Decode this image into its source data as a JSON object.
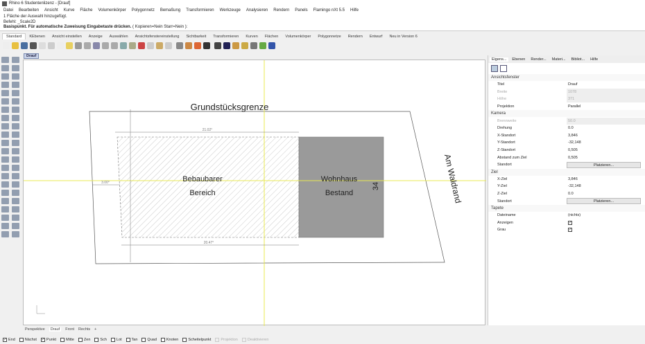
{
  "window": {
    "title": "Rhino 6 Studentenlizenz - [Drauf]"
  },
  "menu": [
    "Datei",
    "Bearbeiten",
    "Ansicht",
    "Kurve",
    "Fläche",
    "Volumenkörper",
    "Polygonnetz",
    "Bemaßung",
    "Transformieren",
    "Werkzeuge",
    "Analysieren",
    "Rendern",
    "Panels",
    "Flamingo nXt 5.5",
    "Hilfe"
  ],
  "command": {
    "history": [
      "1 Fläche der Auswahl hinzugefügt.",
      "Befehl: _Scale2D"
    ],
    "prompt": "Basispunkt. Für automatische Zuweisung Eingabetaste drücken.",
    "options": "( Kopieren=Nein  Starr=Nein ):"
  },
  "toolbar_tabs": [
    "Standard",
    "KEbenen",
    "Ansicht einstellen",
    "Anzeige",
    "Auswählen",
    "Ansichtsfenstereinstellung",
    "Sichtbarkeit",
    "Transformieren",
    "Kurven",
    "Flächen",
    "Volumenkörper",
    "Polygonnetze",
    "Rendern",
    "Entwurf",
    "Neu in Version 6"
  ],
  "viewport": {
    "name": "Drauf",
    "labels": {
      "plot": "Grundstücksgrenze",
      "area1": "Bebaubarer",
      "area2": "Bereich",
      "house1": "Wohnhaus",
      "house2": "Bestand",
      "number": "34",
      "street": "Am Waldrand",
      "dim_top": "21.02°",
      "dim_bottom": "20.47°",
      "dim_left": "3.00°"
    }
  },
  "view_tabs": [
    "Perspektive",
    "Drauf",
    "Front",
    "Rechts"
  ],
  "osnaps": [
    {
      "label": "End",
      "checked": true
    },
    {
      "label": "Nächst",
      "checked": false
    },
    {
      "label": "Punkt",
      "checked": true
    },
    {
      "label": "Mitte",
      "checked": false
    },
    {
      "label": "Zen",
      "checked": false
    },
    {
      "label": "Sch",
      "checked": false
    },
    {
      "label": "Lot",
      "checked": false
    },
    {
      "label": "Tan",
      "checked": false
    },
    {
      "label": "Quad",
      "checked": false
    },
    {
      "label": "Knoten",
      "checked": false
    },
    {
      "label": "Scheitelpunkt",
      "checked": false
    },
    {
      "label": "Projektion",
      "checked": false,
      "disabled": true
    },
    {
      "label": "Deaktivieren",
      "checked": false,
      "disabled": true
    }
  ],
  "panel": {
    "tabs": [
      "Eigens...",
      "Ebenen",
      "Render...",
      "Materi...",
      "Bibliot...",
      "Hilfe"
    ],
    "sections": [
      {
        "title": "Ansichtsfenster",
        "rows": [
          {
            "k": "Titel",
            "v": "Drauf"
          },
          {
            "k": "Breite",
            "v": "1078",
            "gray": true
          },
          {
            "k": "Höhe",
            "v": "371",
            "gray": true
          },
          {
            "k": "Projektion",
            "v": "Parallel"
          }
        ]
      },
      {
        "title": "Kamera",
        "rows": [
          {
            "k": "Brennweite",
            "v": "50.0",
            "gray": true
          },
          {
            "k": "Drehung",
            "v": "0.0"
          },
          {
            "k": "X-Standort",
            "v": "3,846"
          },
          {
            "k": "Y-Standort",
            "v": "-32,148"
          },
          {
            "k": "Z-Standort",
            "v": "0,505"
          },
          {
            "k": "Abstand zum Ziel",
            "v": "0,505"
          },
          {
            "k": "Standort",
            "btn": "Platzieren..."
          }
        ]
      },
      {
        "title": "Ziel",
        "rows": [
          {
            "k": "X-Ziel",
            "v": "3,846"
          },
          {
            "k": "Y-Ziel",
            "v": "-32,148"
          },
          {
            "k": "Z-Ziel",
            "v": "0.0"
          },
          {
            "k": "Standort",
            "btn": "Platzieren..."
          }
        ]
      },
      {
        "title": "Tapete",
        "rows": [
          {
            "k": "Dateiname",
            "v": "(nichts)"
          },
          {
            "k": "Anzeigen",
            "check": true
          },
          {
            "k": "Grau",
            "check": true
          }
        ]
      }
    ]
  },
  "colors": {
    "crosshair": "#e8e850",
    "house": "#9a9a9a"
  }
}
